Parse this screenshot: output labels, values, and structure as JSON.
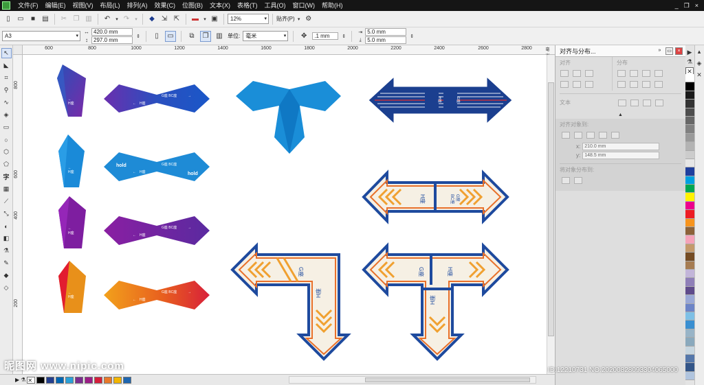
{
  "menubar": {
    "items": [
      "文件(F)",
      "编辑(E)",
      "视图(V)",
      "布局(L)",
      "排列(A)",
      "效果(C)",
      "位图(B)",
      "文本(X)",
      "表格(T)",
      "工具(O)",
      "窗口(W)",
      "帮助(H)"
    ],
    "win_min": "_",
    "win_restore": "❐",
    "win_close": "×"
  },
  "toolbar1": {
    "zoom": "12%",
    "snap_label": "贴齐(P)"
  },
  "toolbar2": {
    "paper_size": "A3",
    "width": "420.0 mm",
    "height": "297.0 mm",
    "units_label": "单位:",
    "units_value": "毫米",
    "nudge": ".1 mm",
    "dup_x": "5.0 mm",
    "dup_y": "5.0 mm"
  },
  "ruler": {
    "top_labels": [
      "600",
      "800",
      "1000",
      "1200",
      "1400",
      "1600",
      "1800",
      "2000",
      "2200",
      "2400",
      "2600",
      "2800"
    ],
    "top_unit": "毫米",
    "left_labels": [
      "800",
      "600",
      "400",
      "200"
    ]
  },
  "canvas": {
    "h_label": "H座",
    "g_label": "G座",
    "gbc_label": "G座 BC座",
    "g_vertical": "G座",
    "bc_vertical": "BC座",
    "arrow": "←",
    "holo": "hold"
  },
  "docker": {
    "title": "对齐与分布...",
    "align_label": "对齐",
    "distribute_label": "分布",
    "text_label": "文本",
    "align_to_label": "对齐对象到:",
    "x_label": "x:",
    "x_value": "210.0 mm",
    "y_label": "y:",
    "y_value": "148.5 mm",
    "distribute_to_label": "将对象分布到:"
  },
  "watermark": {
    "left": "昵图网 www.nipic.com",
    "right": "ID:12210731 NO:20200828093304065000"
  },
  "palette_colors": [
    "#ffffff",
    "#000000",
    "#1a1a1a",
    "#333333",
    "#4d4d4d",
    "#666666",
    "#808080",
    "#999999",
    "#b3b3b3",
    "#cccccc",
    "#e6e6e6",
    "#1f3f9e",
    "#00a0e0",
    "#00a651",
    "#fff200",
    "#ec008c",
    "#ed1c24",
    "#f7941d",
    "#8c6239",
    "#f5a3b9",
    "#c49a6c",
    "#754c24",
    "#a67c52",
    "#c2b5d9",
    "#8f7fb8",
    "#5f4b8b",
    "#9aa8d6",
    "#6d84c7",
    "#7ec0e6",
    "#3a8fd1",
    "#98b4c7",
    "#8aa9bd",
    "#c7d6e0",
    "#5577aa",
    "#335588",
    "#b0c4de"
  ],
  "status_swatches": [
    "#000000",
    "#233f8e",
    "#0066b3",
    "#2aa0d8",
    "#7b2c8f",
    "#9b1d86",
    "#d51f3b",
    "#e8792a",
    "#f2b500",
    "#1e66b0"
  ]
}
